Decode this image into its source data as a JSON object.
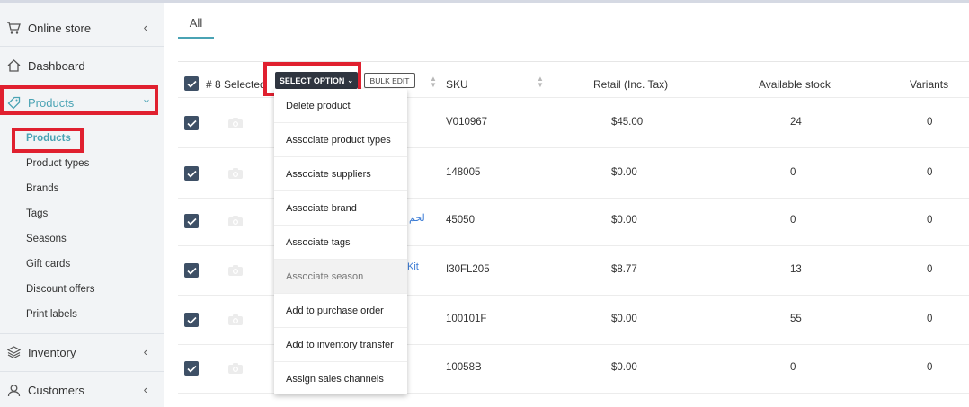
{
  "sidebar": {
    "online_store": "Online store",
    "dashboard": "Dashboard",
    "products": "Products",
    "sub_items": [
      "Products",
      "Product types",
      "Brands",
      "Tags",
      "Seasons",
      "Gift cards",
      "Discount offers",
      "Print labels"
    ],
    "inventory": "Inventory",
    "customers": "Customers"
  },
  "tabs": {
    "all": "All"
  },
  "table": {
    "selected_label": "# 8 Selected",
    "select_option": "SELECT OPTION",
    "bulk_edit": "BULK EDIT",
    "headers": {
      "sku": "SKU",
      "retail": "Retail (Inc. Tax)",
      "stock": "Available stock",
      "variants": "Variants"
    },
    "rows": [
      {
        "partial_name": "",
        "sku": "V010967",
        "retail": "$45.00",
        "stock": "24",
        "variants": "0"
      },
      {
        "partial_name": "",
        "sku": "148005",
        "retail": "$0.00",
        "stock": "0",
        "variants": "0"
      },
      {
        "partial_name": "لحم",
        "sku": "45050",
        "retail": "$0.00",
        "stock": "0",
        "variants": "0"
      },
      {
        "partial_name": "Kit",
        "sku": "I30FL205",
        "retail": "$8.77",
        "stock": "13",
        "variants": "0"
      },
      {
        "partial_name": "",
        "sku": "100101F",
        "retail": "$0.00",
        "stock": "55",
        "variants": "0"
      },
      {
        "partial_name": "",
        "sku": "10058B",
        "retail": "$0.00",
        "stock": "0",
        "variants": "0"
      }
    ]
  },
  "dropdown": {
    "items": [
      "Delete product",
      "Associate product types",
      "Associate suppliers",
      "Associate brand",
      "Associate tags",
      "Associate season",
      "Add to purchase order",
      "Add to inventory transfer",
      "Assign sales channels"
    ],
    "hovered_index": 5
  },
  "colors": {
    "accent": "#4aa3b4",
    "highlight": "#e0202f",
    "checkbox": "#3e5066"
  }
}
